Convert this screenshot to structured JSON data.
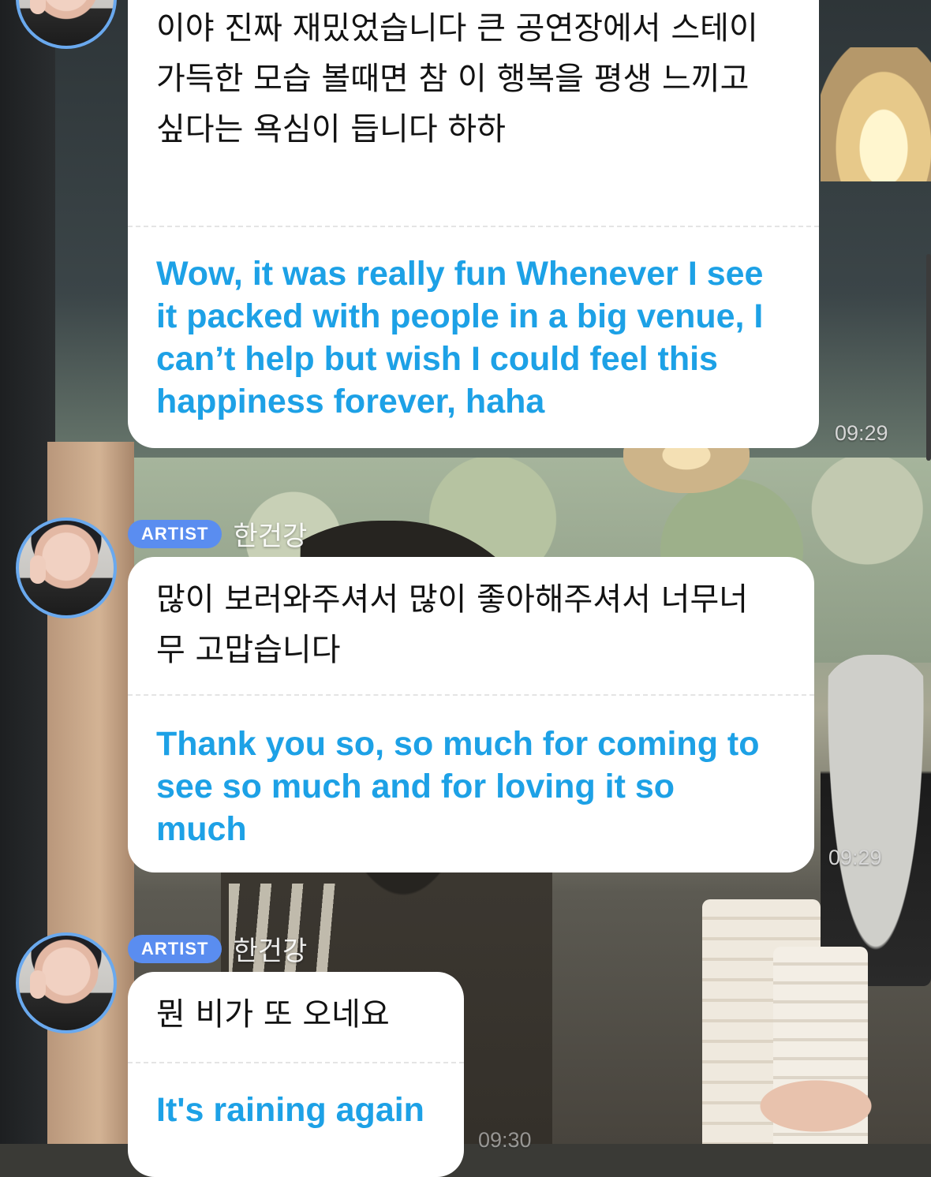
{
  "messages": [
    {
      "badge": "",
      "author": "",
      "korean": "이야 진짜 재밌었습니다 큰 공연장에서 스테이\n가득한 모습 볼때면 참 이 행복을 평생 느끼고\n싶다는 욕심이 듭니다 하하",
      "english": "Wow, it was really fun Whenever I see\nit packed with people in a big venue, I\ncan’t help but wish I could feel this\nhappiness forever, haha",
      "time": "09:29"
    },
    {
      "badge": "ARTIST",
      "author": "한건강",
      "korean": "많이 보러와주셔서 많이 좋아해주셔서 너무너\n무 고맙습니다",
      "english": "Thank you so, so much for coming to\nsee so much and for loving it so\nmuch",
      "time": "09:29"
    },
    {
      "badge": "ARTIST",
      "author": "한건강",
      "korean": "뭔 비가 또 오네요",
      "english": "It's raining again",
      "time": "09:30"
    }
  ],
  "colors": {
    "badge": "#5a8df0",
    "translation": "#1da1e6",
    "avatar_ring": "#6aa9ee",
    "bubble": "#ffffff"
  }
}
